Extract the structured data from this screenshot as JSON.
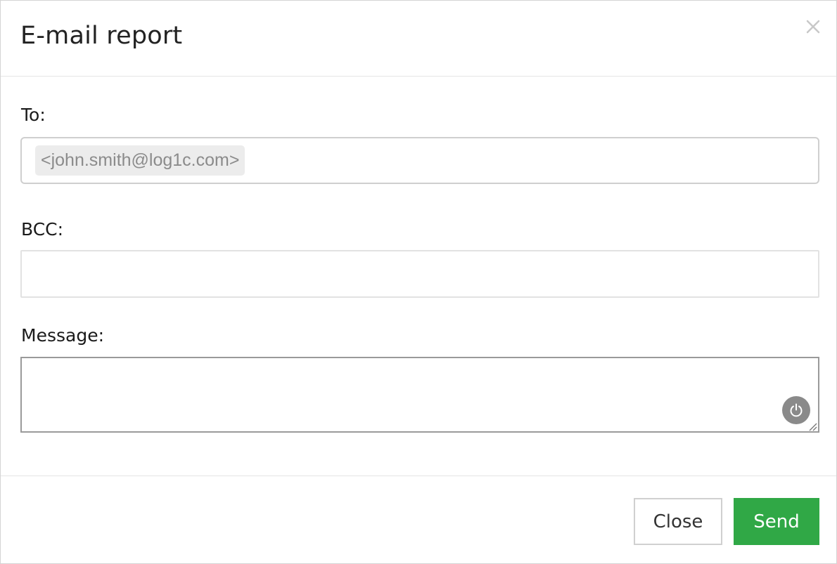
{
  "dialog": {
    "title": "E-mail report"
  },
  "form": {
    "to": {
      "label": "To:",
      "recipients": [
        "<john.smith@log1c.com>"
      ]
    },
    "bcc": {
      "label": "BCC:",
      "value": ""
    },
    "message": {
      "label": "Message:",
      "value": ""
    }
  },
  "footer": {
    "close_label": "Close",
    "send_label": "Send"
  },
  "colors": {
    "send_button_bg": "#30a846",
    "tag_bg": "#ececec",
    "power_button_bg": "#8a8a8a"
  },
  "icons": {
    "dismiss": "close-x-icon",
    "assistant": "power-icon",
    "resize": "resize-grip-icon"
  }
}
